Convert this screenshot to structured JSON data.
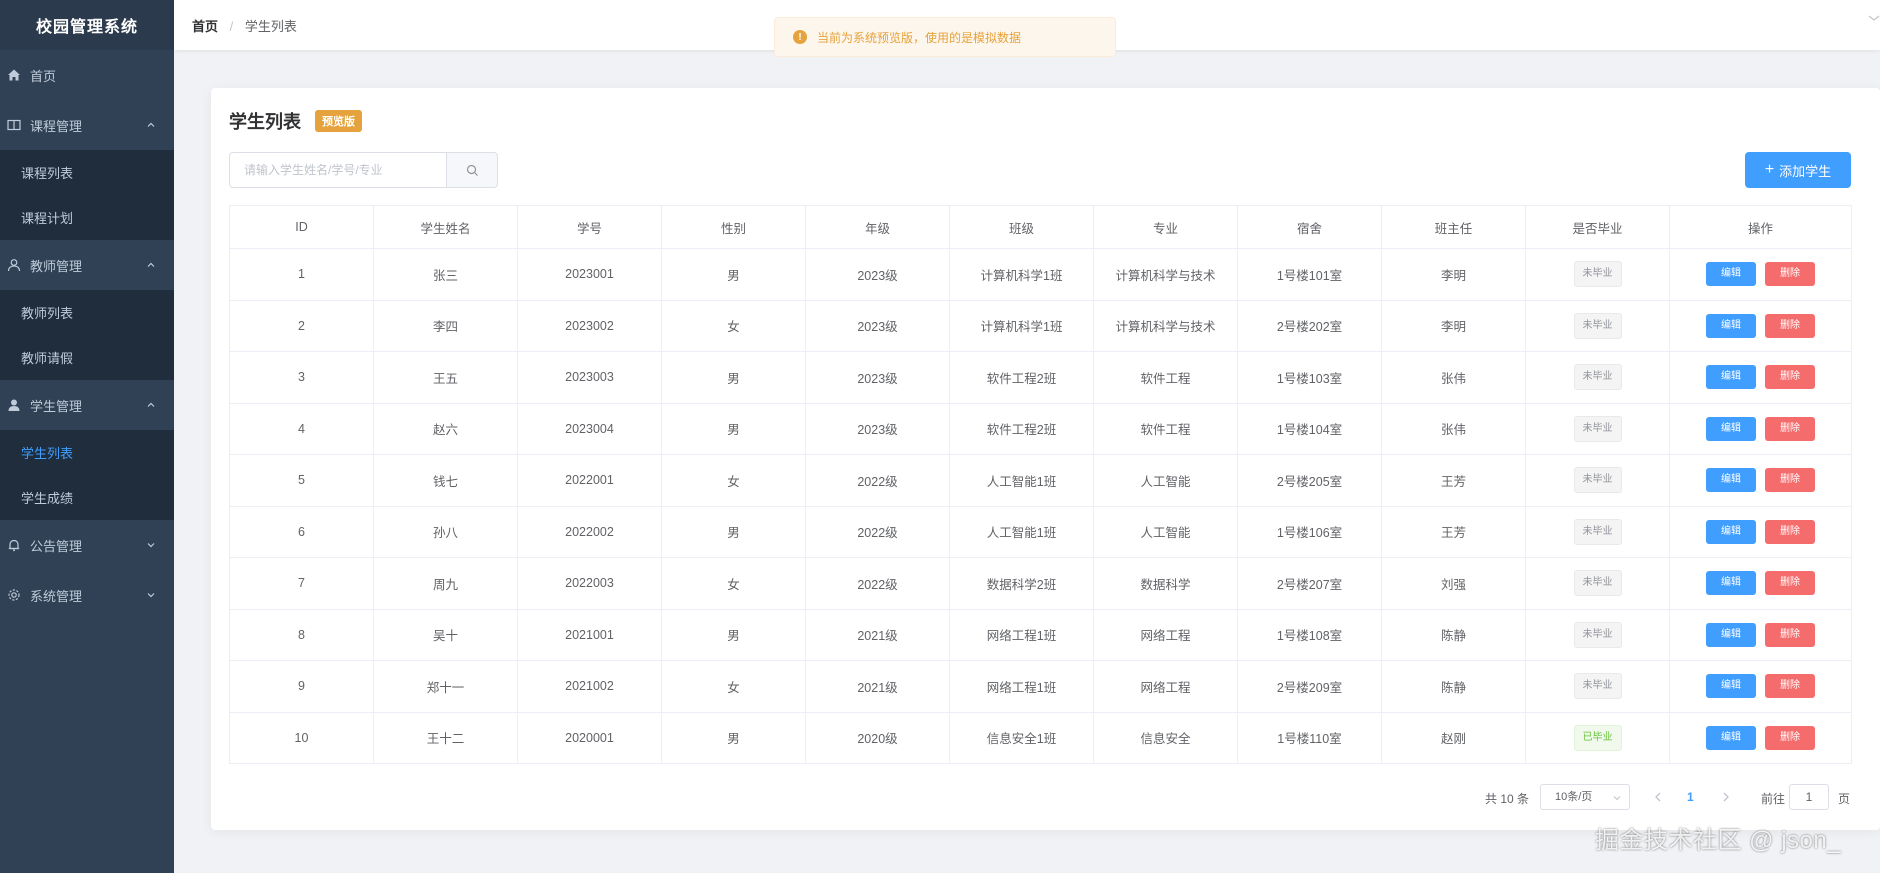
{
  "app": {
    "title": "校园管理系统"
  },
  "sidebar": {
    "home": "首页",
    "course": {
      "label": "课程管理",
      "items": [
        "课程列表",
        "课程计划"
      ]
    },
    "teacher": {
      "label": "教师管理",
      "items": [
        "教师列表",
        "教师请假"
      ]
    },
    "student": {
      "label": "学生管理",
      "items": [
        "学生列表",
        "学生成绩"
      ],
      "active": "学生列表"
    },
    "notice": "公告管理",
    "system": "系统管理"
  },
  "breadcrumb": {
    "home": "首页",
    "sep": "/",
    "current": "学生列表"
  },
  "notice_bar": {
    "text": "当前为系统预览版，使用的是模拟数据",
    "icon": "warning-icon"
  },
  "page": {
    "title": "学生列表",
    "badge": "预览版",
    "add_button": "添加学生",
    "search_placeholder": "请输入学生姓名/学号/专业"
  },
  "table": {
    "headers": [
      "ID",
      "学生姓名",
      "学号",
      "性别",
      "年级",
      "班级",
      "专业",
      "宿舍",
      "班主任",
      "是否毕业",
      "操作"
    ],
    "rows": [
      {
        "id": "1",
        "name": "张三",
        "sno": "2023001",
        "gender": "男",
        "grade": "2023级",
        "class": "计算机科学1班",
        "major": "计算机科学与技术",
        "dorm": "1号楼101室",
        "teacher": "李明",
        "graduated": "未毕业",
        "is_grad": false
      },
      {
        "id": "2",
        "name": "李四",
        "sno": "2023002",
        "gender": "女",
        "grade": "2023级",
        "class": "计算机科学1班",
        "major": "计算机科学与技术",
        "dorm": "2号楼202室",
        "teacher": "李明",
        "graduated": "未毕业",
        "is_grad": false
      },
      {
        "id": "3",
        "name": "王五",
        "sno": "2023003",
        "gender": "男",
        "grade": "2023级",
        "class": "软件工程2班",
        "major": "软件工程",
        "dorm": "1号楼103室",
        "teacher": "张伟",
        "graduated": "未毕业",
        "is_grad": false
      },
      {
        "id": "4",
        "name": "赵六",
        "sno": "2023004",
        "gender": "男",
        "grade": "2023级",
        "class": "软件工程2班",
        "major": "软件工程",
        "dorm": "1号楼104室",
        "teacher": "张伟",
        "graduated": "未毕业",
        "is_grad": false
      },
      {
        "id": "5",
        "name": "钱七",
        "sno": "2022001",
        "gender": "女",
        "grade": "2022级",
        "class": "人工智能1班",
        "major": "人工智能",
        "dorm": "2号楼205室",
        "teacher": "王芳",
        "graduated": "未毕业",
        "is_grad": false
      },
      {
        "id": "6",
        "name": "孙八",
        "sno": "2022002",
        "gender": "男",
        "grade": "2022级",
        "class": "人工智能1班",
        "major": "人工智能",
        "dorm": "1号楼106室",
        "teacher": "王芳",
        "graduated": "未毕业",
        "is_grad": false
      },
      {
        "id": "7",
        "name": "周九",
        "sno": "2022003",
        "gender": "女",
        "grade": "2022级",
        "class": "数据科学2班",
        "major": "数据科学",
        "dorm": "2号楼207室",
        "teacher": "刘强",
        "graduated": "未毕业",
        "is_grad": false
      },
      {
        "id": "8",
        "name": "吴十",
        "sno": "2021001",
        "gender": "男",
        "grade": "2021级",
        "class": "网络工程1班",
        "major": "网络工程",
        "dorm": "1号楼108室",
        "teacher": "陈静",
        "graduated": "未毕业",
        "is_grad": false
      },
      {
        "id": "9",
        "name": "郑十一",
        "sno": "2021002",
        "gender": "女",
        "grade": "2021级",
        "class": "网络工程1班",
        "major": "网络工程",
        "dorm": "2号楼209室",
        "teacher": "陈静",
        "graduated": "未毕业",
        "is_grad": false
      },
      {
        "id": "10",
        "name": "王十二",
        "sno": "2020001",
        "gender": "男",
        "grade": "2020级",
        "class": "信息安全1班",
        "major": "信息安全",
        "dorm": "1号楼110室",
        "teacher": "赵刚",
        "graduated": "已毕业",
        "is_grad": true
      }
    ],
    "edit_label": "编辑",
    "delete_label": "删除"
  },
  "pagination": {
    "total": "共 10 条",
    "page_size": "10条/页",
    "current": "1",
    "goto_label": "前往",
    "goto_value": "1",
    "page_unit": "页"
  },
  "watermark": "掘金技术社区 @ json_",
  "colors": {
    "sidebar": "#304156",
    "primary": "#409eff",
    "danger": "#f56c6c",
    "warning": "#e6a23c",
    "success": "#67c23a"
  }
}
